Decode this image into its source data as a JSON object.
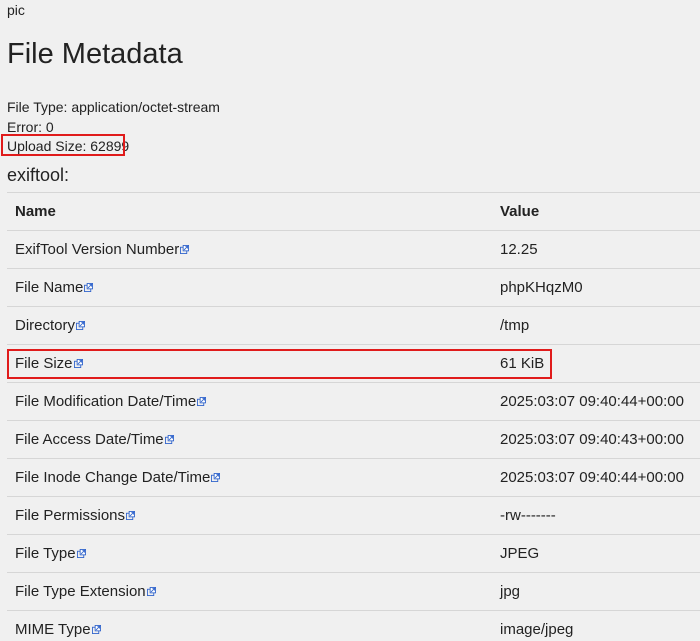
{
  "image_alt": "pic",
  "page_title": "File Metadata",
  "meta": {
    "file_type": "File Type: application/octet-stream",
    "error": "Error: 0",
    "upload_size": "Upload Size: 62899"
  },
  "section_label": "exiftool:",
  "table": {
    "headers": {
      "name": "Name",
      "value": "Value"
    },
    "rows": [
      {
        "name": "ExifTool Version Number",
        "value": "12.25"
      },
      {
        "name": "File Name",
        "value": "phpKHqzM0"
      },
      {
        "name": "Directory",
        "value": "/tmp"
      },
      {
        "name": "File Size",
        "value": "61 KiB"
      },
      {
        "name": "File Modification Date/Time",
        "value": "2025:03:07 09:40:44+00:00"
      },
      {
        "name": "File Access Date/Time",
        "value": "2025:03:07 09:40:43+00:00"
      },
      {
        "name": "File Inode Change Date/Time",
        "value": "2025:03:07 09:40:44+00:00"
      },
      {
        "name": "File Permissions",
        "value": "-rw-------"
      },
      {
        "name": "File Type",
        "value": "JPEG"
      },
      {
        "name": "File Type Extension",
        "value": "jpg"
      },
      {
        "name": "MIME Type",
        "value": "image/jpeg"
      }
    ]
  },
  "colors": {
    "highlight": "#e01b1b",
    "link_icon": "#3366cc",
    "row_border": "#d6d6d6",
    "background": "#f0f0f0"
  },
  "icons": {
    "row_link": "external-link-icon"
  }
}
